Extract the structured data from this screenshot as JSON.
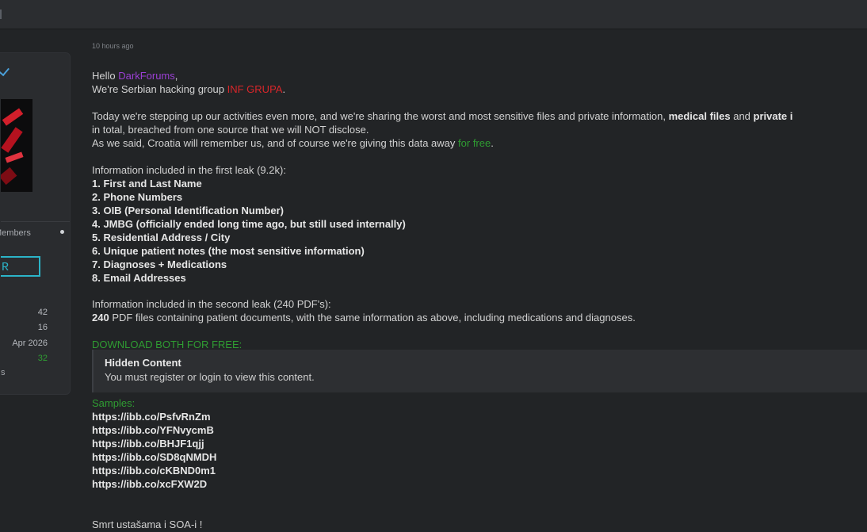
{
  "sidebar": {
    "role_text": "Members",
    "badge_text": "ER",
    "stats": [
      "42",
      "16",
      "Apr 2026",
      "32"
    ],
    "last_fragment": "s"
  },
  "post": {
    "timestamp": "10 hours ago",
    "hello": "Hello ",
    "forum_name": "DarkForums",
    "comma": ",",
    "intro_prefix": "We're Serbian hacking group ",
    "group_name": "INF GRUPA",
    "period": ".",
    "para1_a": "Today we're stepping up our activities even more, and we're sharing the worst and most sensitive files and private information, ",
    "para1_b": "medical files",
    "para1_c": " and ",
    "para1_d": "private i",
    "para1_line2": "in total, breached from one source that we will NOT disclose.",
    "para1_line3_a": "As we said, Croatia will remember us, and of course we're giving this data away ",
    "para1_line3_b": "for free",
    "para1_line3_c": ".",
    "leak1_title": "Information included in the first leak (9.2k):",
    "leak1_items": [
      "1. First and Last Name",
      "2. Phone Numbers",
      "3. OIB (Personal Identification Number)",
      "4. JMBG (officially ended long time ago, but still used internally)",
      "5. Residential Address / City",
      "6. Unique patient notes (the most sensitive information)",
      "7. Diagnoses + Medications",
      "8. Email Addresses"
    ],
    "leak2_title": "Information included in the second leak (240 PDF's):",
    "leak2_count": "240",
    "leak2_desc": " PDF files containing patient documents, with the same information as above, including medications and diagnoses.",
    "download_heading": "DOWNLOAD BOTH FOR FREE:",
    "hidden_title": "Hidden Content",
    "hidden_sub": "You must register or login to view this content.",
    "samples_label": "Samples:",
    "sample_links": [
      "https://ibb.co/PsfvRnZm",
      "https://ibb.co/YFNvycmB",
      "https://ibb.co/BHJF1qjj",
      "https://ibb.co/SD8qNMDH",
      "https://ibb.co/cKBND0m1",
      "https://ibb.co/xcFXW2D"
    ],
    "closing": "Smrt ustašama i SOA-i !"
  }
}
